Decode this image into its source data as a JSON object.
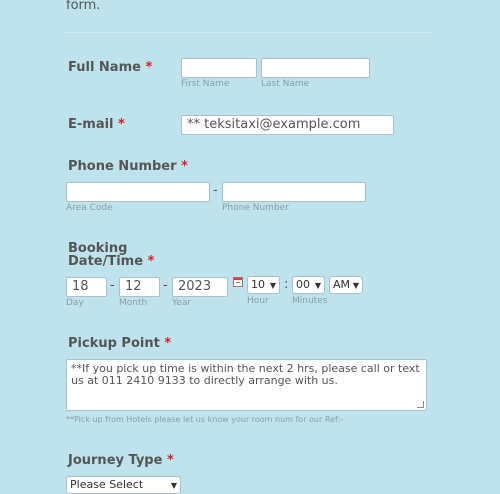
{
  "intro_text": "form.",
  "required_mark": "*",
  "full_name": {
    "label": "Full Name",
    "first_sub": "First Name",
    "last_sub": "Last Name",
    "first_value": "",
    "last_value": ""
  },
  "email": {
    "label": "E-mail",
    "placeholder": "** teksitaxi@example.com"
  },
  "phone": {
    "label": "Phone Number",
    "separator": "-",
    "area_sub": "Area Code",
    "number_sub": "Phone Number"
  },
  "booking": {
    "label_line1": "Booking",
    "label_line2": "Date/Time",
    "day": "18",
    "month": "12",
    "year": "2023",
    "separator": "-",
    "day_sub": "Day",
    "month_sub": "Month",
    "year_sub": "Year",
    "hour": "10",
    "minutes": "00",
    "ampm": "AM",
    "time_sep": ":",
    "hour_sub": "Hour",
    "minutes_sub": "Minutes"
  },
  "pickup": {
    "label": "Pickup Point",
    "placeholder": "**If you pick up time is within the next 2 hrs, please call or text us at 011 2410 9133 to directly arrange with us.",
    "note": "**Pick up from Hotels please let us know your room num for our Ref:-"
  },
  "journey": {
    "label": "Journey Type",
    "selected": "Please Select"
  }
}
